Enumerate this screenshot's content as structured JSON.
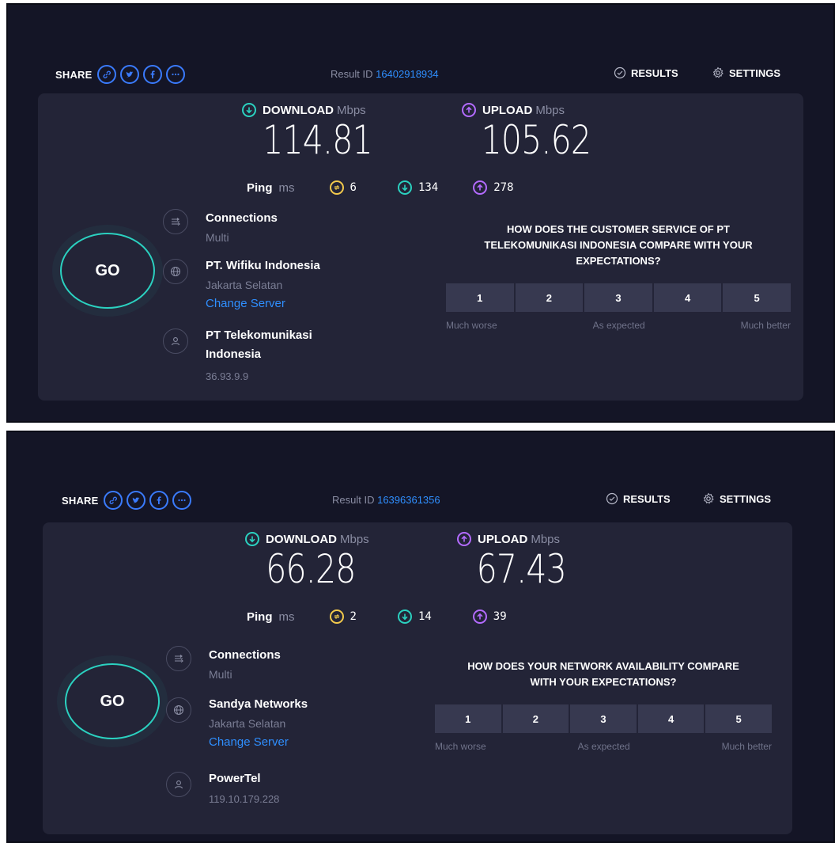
{
  "results": [
    {
      "share_label": "SHARE",
      "share_icons": [
        "link-icon",
        "twitter-icon",
        "facebook-icon",
        "more-icon"
      ],
      "result_id_label": "Result ID",
      "result_id": "16402918934",
      "results_label": "RESULTS",
      "settings_label": "SETTINGS",
      "download_label": "DOWNLOAD",
      "download_unit": "Mbps",
      "download_value": "114.81",
      "upload_label": "UPLOAD",
      "upload_unit": "Mbps",
      "upload_value": "105.62",
      "ping_label": "Ping",
      "ping_unit": "ms",
      "ping_value": "6",
      "ping_download": "134",
      "ping_upload": "278",
      "go_label": "GO",
      "connections_label": "Connections",
      "connections_value": "Multi",
      "server_name": "PT. Wifiku Indonesia",
      "server_location": "Jakarta Selatan",
      "change_server": "Change Server",
      "isp_name": "PT Telekomunikasi Indonesia",
      "ip_address": "36.93.9.9",
      "survey_question": "HOW DOES THE CUSTOMER SERVICE OF PT TELEKOMUNIKASI INDONESIA COMPARE WITH YOUR EXPECTATIONS?",
      "rating_options": [
        "1",
        "2",
        "3",
        "4",
        "5"
      ],
      "rating_low": "Much worse",
      "rating_mid": "As expected",
      "rating_high": "Much better"
    },
    {
      "share_label": "SHARE",
      "share_icons": [
        "link-icon",
        "twitter-icon",
        "facebook-icon",
        "more-icon"
      ],
      "result_id_label": "Result ID",
      "result_id": "16396361356",
      "results_label": "RESULTS",
      "settings_label": "SETTINGS",
      "download_label": "DOWNLOAD",
      "download_unit": "Mbps",
      "download_value": "66.28",
      "upload_label": "UPLOAD",
      "upload_unit": "Mbps",
      "upload_value": "67.43",
      "ping_label": "Ping",
      "ping_unit": "ms",
      "ping_value": "2",
      "ping_download": "14",
      "ping_upload": "39",
      "go_label": "GO",
      "connections_label": "Connections",
      "connections_value": "Multi",
      "server_name": "Sandya Networks",
      "server_location": "Jakarta Selatan",
      "change_server": "Change Server",
      "isp_name": "PowerTel",
      "ip_address": "119.10.179.228",
      "survey_question": "HOW DOES YOUR NETWORK AVAILABILITY COMPARE WITH YOUR EXPECTATIONS?",
      "rating_options": [
        "1",
        "2",
        "3",
        "4",
        "5"
      ],
      "rating_low": "Much worse",
      "rating_mid": "As expected",
      "rating_high": "Much better"
    }
  ],
  "colors": {
    "background": "#141526",
    "card": "#232437",
    "accent_blue": "#2f8fff",
    "download": "#2bd1c0",
    "upload": "#b36bff",
    "ping": "#f2c94c"
  }
}
